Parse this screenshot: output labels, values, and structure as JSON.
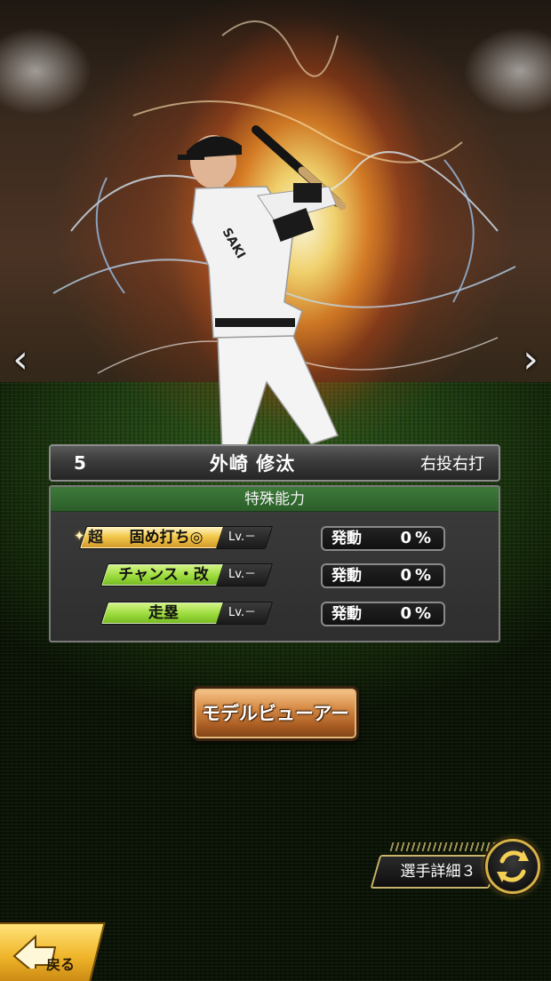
{
  "player": {
    "number": "5",
    "name": "外崎 修汰",
    "handedness": "右投右打"
  },
  "abilities": {
    "header": "特殊能力",
    "items": [
      {
        "super_prefix": "超",
        "name": "固め打ち◎",
        "level": "Lv.－",
        "trigger_label": "発動",
        "trigger_value": "0%",
        "badge_color": "#f0c54a"
      },
      {
        "super_prefix": "",
        "name": "チャンス・改",
        "level": "Lv.－",
        "trigger_label": "発動",
        "trigger_value": "0%",
        "badge_color": "#9cdb3c"
      },
      {
        "super_prefix": "",
        "name": "走塁",
        "level": "Lv.－",
        "trigger_label": "発動",
        "trigger_value": "0%",
        "badge_color": "#9cdb3c"
      }
    ]
  },
  "buttons": {
    "model_viewer": "モデルビューアー",
    "player_detail": "選手詳細３",
    "back": "戻る"
  },
  "icons": {
    "prev": "chevron-left-icon",
    "next": "chevron-right-icon",
    "swap": "swap-arrows-icon",
    "back": "back-arrow-icon",
    "super_star": "sparkle-star-icon"
  },
  "colors": {
    "header_green": "#2b5e28",
    "gold_accent": "#d5b14a",
    "button_brown": "#a85c22"
  }
}
